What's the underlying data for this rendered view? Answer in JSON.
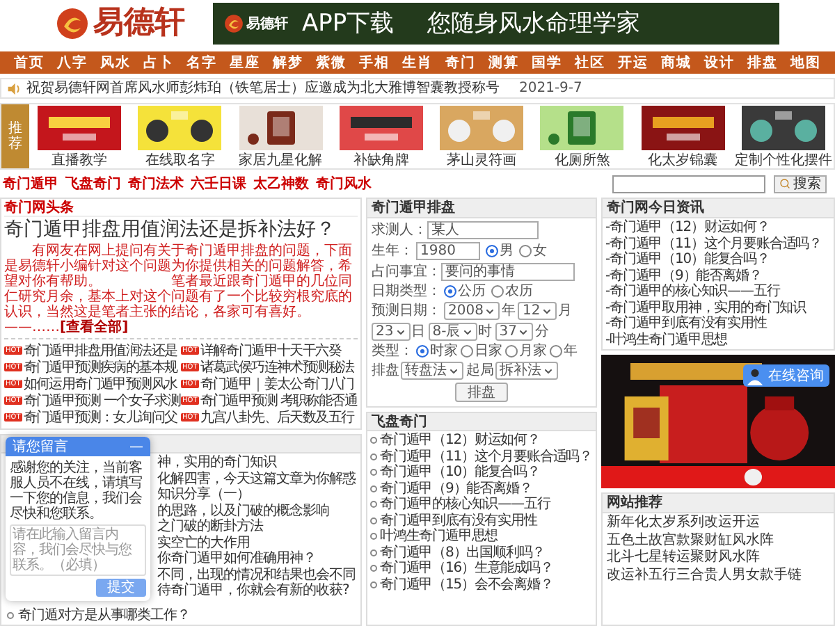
{
  "logo": {
    "text": "易德轩"
  },
  "banner": {
    "brand": "易德轩",
    "title": "APP下载",
    "slogan": "您随身风水命理学家"
  },
  "nav": [
    "首页",
    "八字",
    "风水",
    "占卜",
    "名字",
    "星座",
    "解梦",
    "紫微",
    "手相",
    "生肖",
    "奇门",
    "测算",
    "国学",
    "社区",
    "开运",
    "商城",
    "设计",
    "排盘",
    "地图"
  ],
  "notice": {
    "text": "祝贺易德轩网首席风水师彭炜珀（铁笔居士）应邀成为北大雅博智囊教授称号",
    "date": "2021-9-7"
  },
  "recommend": {
    "label": "推荐",
    "items": [
      {
        "caption": "直播教学"
      },
      {
        "caption": "在线取名字"
      },
      {
        "caption": "家居九星化解"
      },
      {
        "caption": "补缺角牌"
      },
      {
        "caption": "茅山灵符画"
      },
      {
        "caption": "化厕所煞"
      },
      {
        "caption": "化太岁锦囊"
      },
      {
        "caption": "定制个性化摆件"
      }
    ]
  },
  "tags": [
    "奇门遁甲",
    "飞盘奇门",
    "奇门法术",
    "六壬日课",
    "太乙神数",
    "奇门风水"
  ],
  "search": {
    "button": "搜索"
  },
  "headline_section": {
    "title": "奇门网头条",
    "headline": "奇门遁甲排盘用值润法还是拆补法好？",
    "summary": "有网友在网上提问有关于奇门遁甲排盘的问题，下面是易德轩小编针对这个问题为你提供相关的问题解答，希望对你有帮助。　　　　　笔者最近跟奇门遁甲的几位同仁研究月余，基本上对这个问题有了一个比较穷根究底的认识，当然这是笔者主张的结论，各家可有喜好。——……",
    "more": "[查看全部]",
    "items": [
      {
        "badge": "HOT",
        "text": "奇门遁甲排盘用值润法还是"
      },
      {
        "badge": "HOT",
        "text": "详解奇门遁甲十天干六癸"
      },
      {
        "badge": "HOT",
        "text": "奇门遁甲预测疾病的基本规"
      },
      {
        "badge": "HOT",
        "text": "诸葛武侯巧连神术预测秘法"
      },
      {
        "badge": "HOT",
        "text": "如何运用奇门遁甲预测风水"
      },
      {
        "badge": "HOT",
        "text": "奇门遁甲｜姜太公奇门八门"
      },
      {
        "badge": "HOT",
        "text": "奇门遁甲预测 一个女子求测"
      },
      {
        "badge": "HOT",
        "text": "奇门遁甲预测 考职称能否通"
      },
      {
        "badge": "HOT",
        "text": "奇门遁甲预测：女儿询问父"
      },
      {
        "badge": "HOT",
        "text": "九宫八卦先、后天数及五行"
      }
    ]
  },
  "paipan": {
    "title": "奇门遁甲排盘",
    "name": {
      "label": "求测人：",
      "value": "某人"
    },
    "birth_year": {
      "label": "生年：",
      "value": "1980",
      "genders": [
        {
          "label": "男",
          "selected": true
        },
        {
          "label": "女",
          "selected": false
        }
      ]
    },
    "question": {
      "label": "占问事宜：",
      "value": "要问的事情"
    },
    "date_type": {
      "label": "日期类型：",
      "options": [
        {
          "label": "公历",
          "selected": true
        },
        {
          "label": "农历",
          "selected": false
        }
      ]
    },
    "date": {
      "label": "预测日期：",
      "parts": [
        {
          "value": "2008",
          "unit": "年"
        },
        {
          "value": "12",
          "unit": "月"
        },
        {
          "value": "23",
          "unit": "日"
        },
        {
          "value": "8-辰",
          "unit": "时"
        },
        {
          "value": "37",
          "unit": "分"
        }
      ]
    },
    "type": {
      "label": "类型：",
      "options": [
        {
          "label": "时家",
          "selected": true
        },
        {
          "label": "日家",
          "selected": false
        },
        {
          "label": "月家",
          "selected": false
        },
        {
          "label": "年",
          "selected": false
        }
      ]
    },
    "selects": [
      {
        "label": "排盘",
        "value": "转盘法"
      },
      {
        "label": "起局",
        "value": "拆补法"
      }
    ],
    "submit": "排盘"
  },
  "lower_list": {
    "items": [
      "神，实用的奇门知识",
      "化解四害，今天这篇文章为你解惑",
      "知识分享（一）",
      "的思路，以及门破的概念影响",
      "之门破的断卦方法",
      "实空亡的大作用",
      "你奇门遁甲如何准确用神？",
      "不同，出现的情况和结果也会不同",
      "待奇门遁甲，你就会有新的收获?",
      "奇门遁对方是从事哪类工作？"
    ]
  },
  "feipan": {
    "title": "飞盘奇门",
    "items": [
      "奇门遁甲（12）财运如何？",
      "奇门遁甲（11）这个月要账合适吗？",
      "奇门遁甲（10）能复合吗？",
      "奇门遁甲（9）能否离婚？",
      "奇门遁甲的核心知识——五行",
      "奇门遁甲到底有没有实用性",
      "叶鸿生奇门遁甲思想",
      "奇门遁甲（8）出国顺利吗？",
      "奇门遁甲（16）生意能成吗？",
      "奇门遁甲（15）会不会离婚？"
    ]
  },
  "news": {
    "title": "奇门网今日资讯",
    "items": [
      "-奇门遁甲（12）财运如何？",
      "-奇门遁甲（11）这个月要账合适吗？",
      "-奇门遁甲（10）能复合吗？",
      "-奇门遁甲（9）能否离婚？",
      "-奇门遁甲的核心知识——五行",
      "-奇门遁甲取用神，实用的奇门知识",
      "-奇门遁甲到底有没有实用性",
      "-叶鸿生奇门遁甲思想"
    ]
  },
  "site_recommend": {
    "title": "网站推荐",
    "items": [
      "新年化太岁系列改运开运",
      "五色土故宫款聚财缸风水阵",
      "北斗七星转运聚财风水阵",
      "改运补五行三合贵人男女款手链"
    ]
  },
  "consult": {
    "label": "在线咨询"
  },
  "chat": {
    "title": "请您留言",
    "minimize": "—",
    "message": "感谢您的关注，当前客服人员不在线，请填写一下您的信息，我们会尽快和您联系。",
    "placeholder": "请在此输入留言内容，我们会尽快与您联系。（必填）",
    "submit": "提交"
  }
}
